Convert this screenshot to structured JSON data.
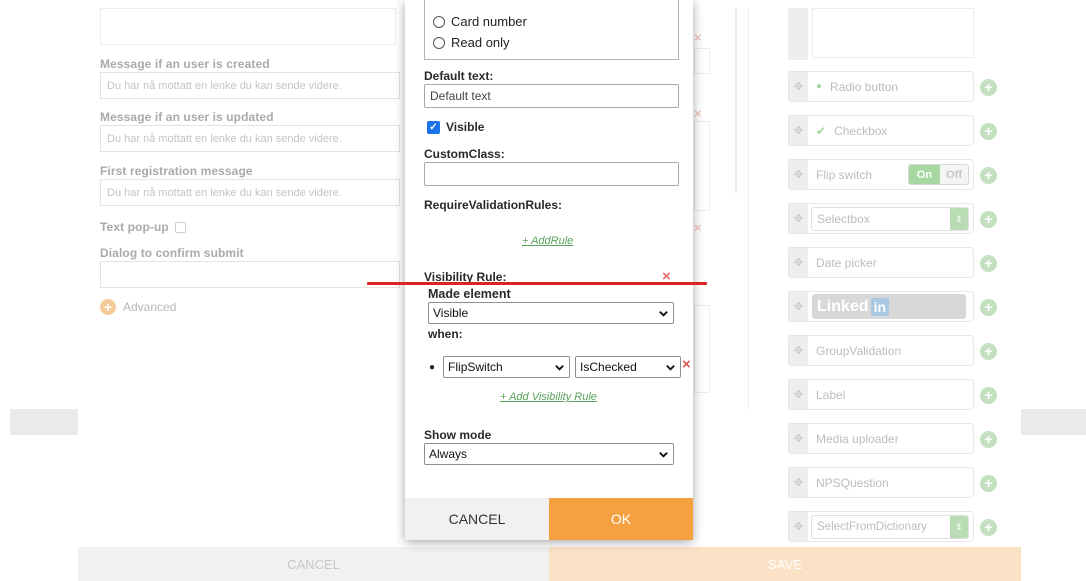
{
  "left_form": {
    "msg_created_label": "Message if an user is created",
    "msg_created_value": "Du har nå mottatt en lenke du kan sende videre.",
    "msg_updated_label": "Message if an user is updated",
    "msg_updated_value": "Du har nå mottatt en lenke du kan sende videre.",
    "first_reg_label": "First registration message",
    "first_reg_value": "Du har nå mottatt en lenke du kan sende videre.",
    "text_popup_label": "Text pop-up",
    "dialog_confirm_label": "Dialog to confirm submit",
    "advanced_label": "Advanced"
  },
  "palette": {
    "items": [
      {
        "label": "Radio button",
        "icon": "radio-dot"
      },
      {
        "label": "Checkbox",
        "icon": "check"
      },
      {
        "label": "Flip switch",
        "switch_on": "On",
        "switch_off": "Off"
      },
      {
        "label": "Selectbox"
      },
      {
        "label": "Date picker"
      },
      {
        "label": "Linked",
        "badge": "in"
      },
      {
        "label": "GroupValidation"
      },
      {
        "label": "Label"
      },
      {
        "label": "Media uploader"
      },
      {
        "label": "NPSQuestion"
      },
      {
        "label": "SelectFromDictionary"
      }
    ]
  },
  "bottom": {
    "cancel_label": "CANCEL",
    "save_label": "SAVE"
  },
  "modal": {
    "options": [
      "Card number",
      "Read only"
    ],
    "default_text_label": "Default text:",
    "default_text_value": "Default text",
    "visible_label": "Visible",
    "visible_checked": true,
    "custom_class_label": "CustomClass:",
    "custom_class_value": "",
    "require_rules_label": "RequireValidationRules:",
    "add_rule_link": "+ AddRule",
    "visibility_rule_label": "Visibility Rule:",
    "made_element_label": "Made element",
    "made_element_value": "Visible",
    "when_label": "when:",
    "condition_field": "FlipSwitch",
    "condition_operator": "IsChecked",
    "add_visibility_rule_link": "+ Add Visibility Rule",
    "show_mode_label": "Show mode",
    "show_mode_value": "Always",
    "cancel_label": "CANCEL",
    "ok_label": "OK"
  },
  "colors": {
    "accent_orange": "#f5a142",
    "link_green": "#5aa25a",
    "delete_red": "#e05555",
    "annotation_line": "#dd2222",
    "checkbox_blue": "#1a73e8"
  }
}
